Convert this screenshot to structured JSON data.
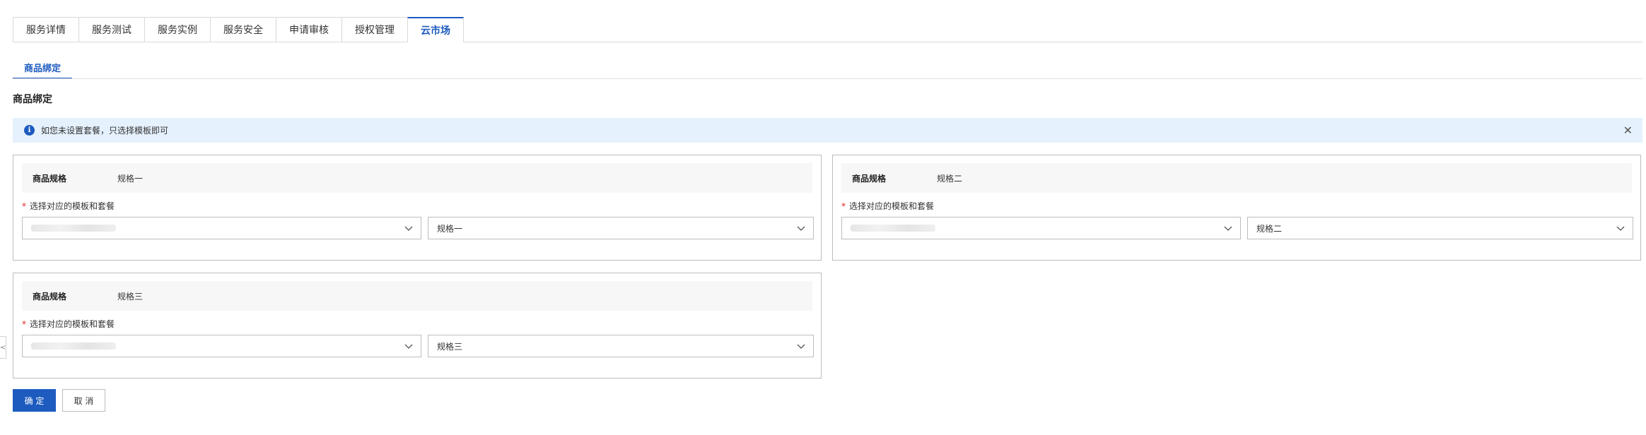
{
  "tabs": [
    {
      "label": "服务详情",
      "active": false
    },
    {
      "label": "服务测试",
      "active": false
    },
    {
      "label": "服务实例",
      "active": false
    },
    {
      "label": "服务安全",
      "active": false
    },
    {
      "label": "申请审核",
      "active": false
    },
    {
      "label": "授权管理",
      "active": false
    },
    {
      "label": "云市场",
      "active": true
    }
  ],
  "subtab": {
    "label": "商品绑定"
  },
  "section": {
    "title": "商品绑定"
  },
  "alert": {
    "icon": "info-icon",
    "text": "如您未设置套餐，只选择模板即可",
    "close_icon": "close-icon"
  },
  "cards": [
    {
      "spec_label": "商品规格",
      "spec_value": "规格一",
      "field_label": "选择对应的模板和套餐",
      "required_mark": "*",
      "template_value": "",
      "package_value": "规格一"
    },
    {
      "spec_label": "商品规格",
      "spec_value": "规格二",
      "field_label": "选择对应的模板和套餐",
      "required_mark": "*",
      "template_value": "",
      "package_value": "规格二"
    },
    {
      "spec_label": "商品规格",
      "spec_value": "规格三",
      "field_label": "选择对应的模板和套餐",
      "required_mark": "*",
      "template_value": "",
      "package_value": "规格三"
    }
  ],
  "buttons": {
    "ok": "确 定",
    "cancel": "取 消"
  },
  "side_handle": {
    "icon": "chevron-left-icon",
    "glyph": "<"
  },
  "colors": {
    "accent": "#1d5bbf",
    "alert_bg": "#e5f1fd",
    "required": "#e02020",
    "border": "#bdbdbd"
  }
}
